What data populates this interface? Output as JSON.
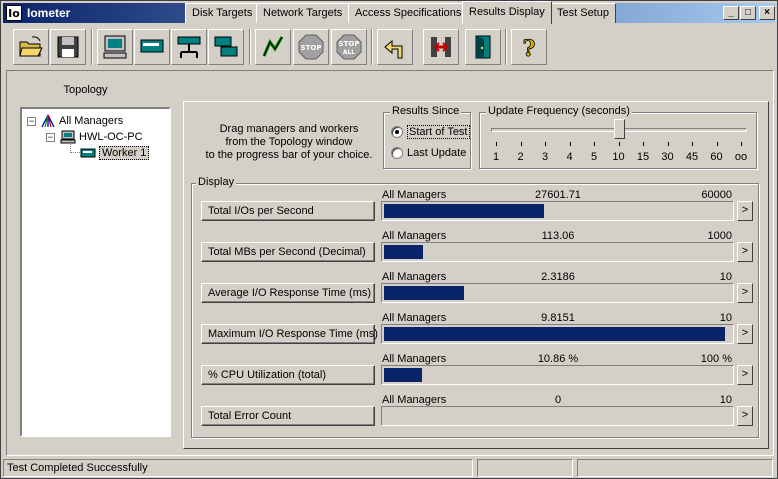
{
  "window": {
    "title": "Iometer",
    "app_icon_text": "Io"
  },
  "titlebar_buttons": {
    "minimize": "_",
    "maximize": "□",
    "close": "×"
  },
  "toolbar": {
    "icons": [
      "open-folder-icon",
      "save-disk-icon",
      "display-icon",
      "new-worker-icon",
      "network-worker-icon",
      "duplicate-worker-icon",
      "start-flag-icon",
      "stop-icon",
      "stop-all-icon",
      "reset-icon",
      "disconnect-icon",
      "exit-icon",
      "help-icon"
    ],
    "stop_label": "STOP",
    "stop_all_label_1": "STOP",
    "stop_all_label_2": "ALL",
    "help_label": "?"
  },
  "topology": {
    "title": "Topology",
    "items": [
      {
        "label": "All Managers",
        "expander": "−"
      },
      {
        "label": "HWL-OC-PC",
        "expander": "−"
      },
      {
        "label": "Worker 1"
      }
    ]
  },
  "tabs": [
    {
      "label": "Disk Targets"
    },
    {
      "label": "Network Targets"
    },
    {
      "label": "Access Specifications"
    },
    {
      "label": "Results Display",
      "active": true
    },
    {
      "label": "Test Setup"
    }
  ],
  "instructions": {
    "line1": "Drag managers and workers",
    "line2": "from the Topology window",
    "line3": "to the progress bar of your choice."
  },
  "results_since": {
    "title": "Results Since",
    "options": [
      {
        "label": "Start of Test",
        "selected": true
      },
      {
        "label": "Last Update",
        "selected": false
      }
    ]
  },
  "update_frequency": {
    "title": "Update Frequency (seconds)",
    "ticks": [
      "1",
      "2",
      "3",
      "4",
      "5",
      "10",
      "15",
      "30",
      "45",
      "60",
      "oo"
    ],
    "selected": "10"
  },
  "display": {
    "title": "Display",
    "arrow_label": ">",
    "rows": [
      {
        "metric": "Total I/Os per Second",
        "source": "All Managers",
        "value": "27601.71",
        "max": "60000",
        "fraction": 0.46
      },
      {
        "metric": "Total MBs per Second (Decimal)",
        "source": "All Managers",
        "value": "113.06",
        "max": "1000",
        "fraction": 0.113
      },
      {
        "metric": "Average I/O Response Time (ms)",
        "source": "All Managers",
        "value": "2.3186",
        "max": "10",
        "fraction": 0.2319
      },
      {
        "metric": "Maximum I/O Response Time (ms)",
        "source": "All Managers",
        "value": "9.8151",
        "max": "10",
        "fraction": 0.9815
      },
      {
        "metric": "% CPU Utilization (total)",
        "source": "All Managers",
        "value": "10.86 %",
        "max": "100 %",
        "fraction": 0.1086
      },
      {
        "metric": "Total Error Count",
        "source": "All Managers",
        "value": "0",
        "max": "10",
        "fraction": 0
      }
    ]
  },
  "status_bar": {
    "message": "Test Completed Successfully"
  },
  "colors": {
    "bar": "#0a246a",
    "titlebar_start": "#0a246a",
    "titlebar_end": "#a6caf0",
    "face": "#d4d0c8"
  }
}
